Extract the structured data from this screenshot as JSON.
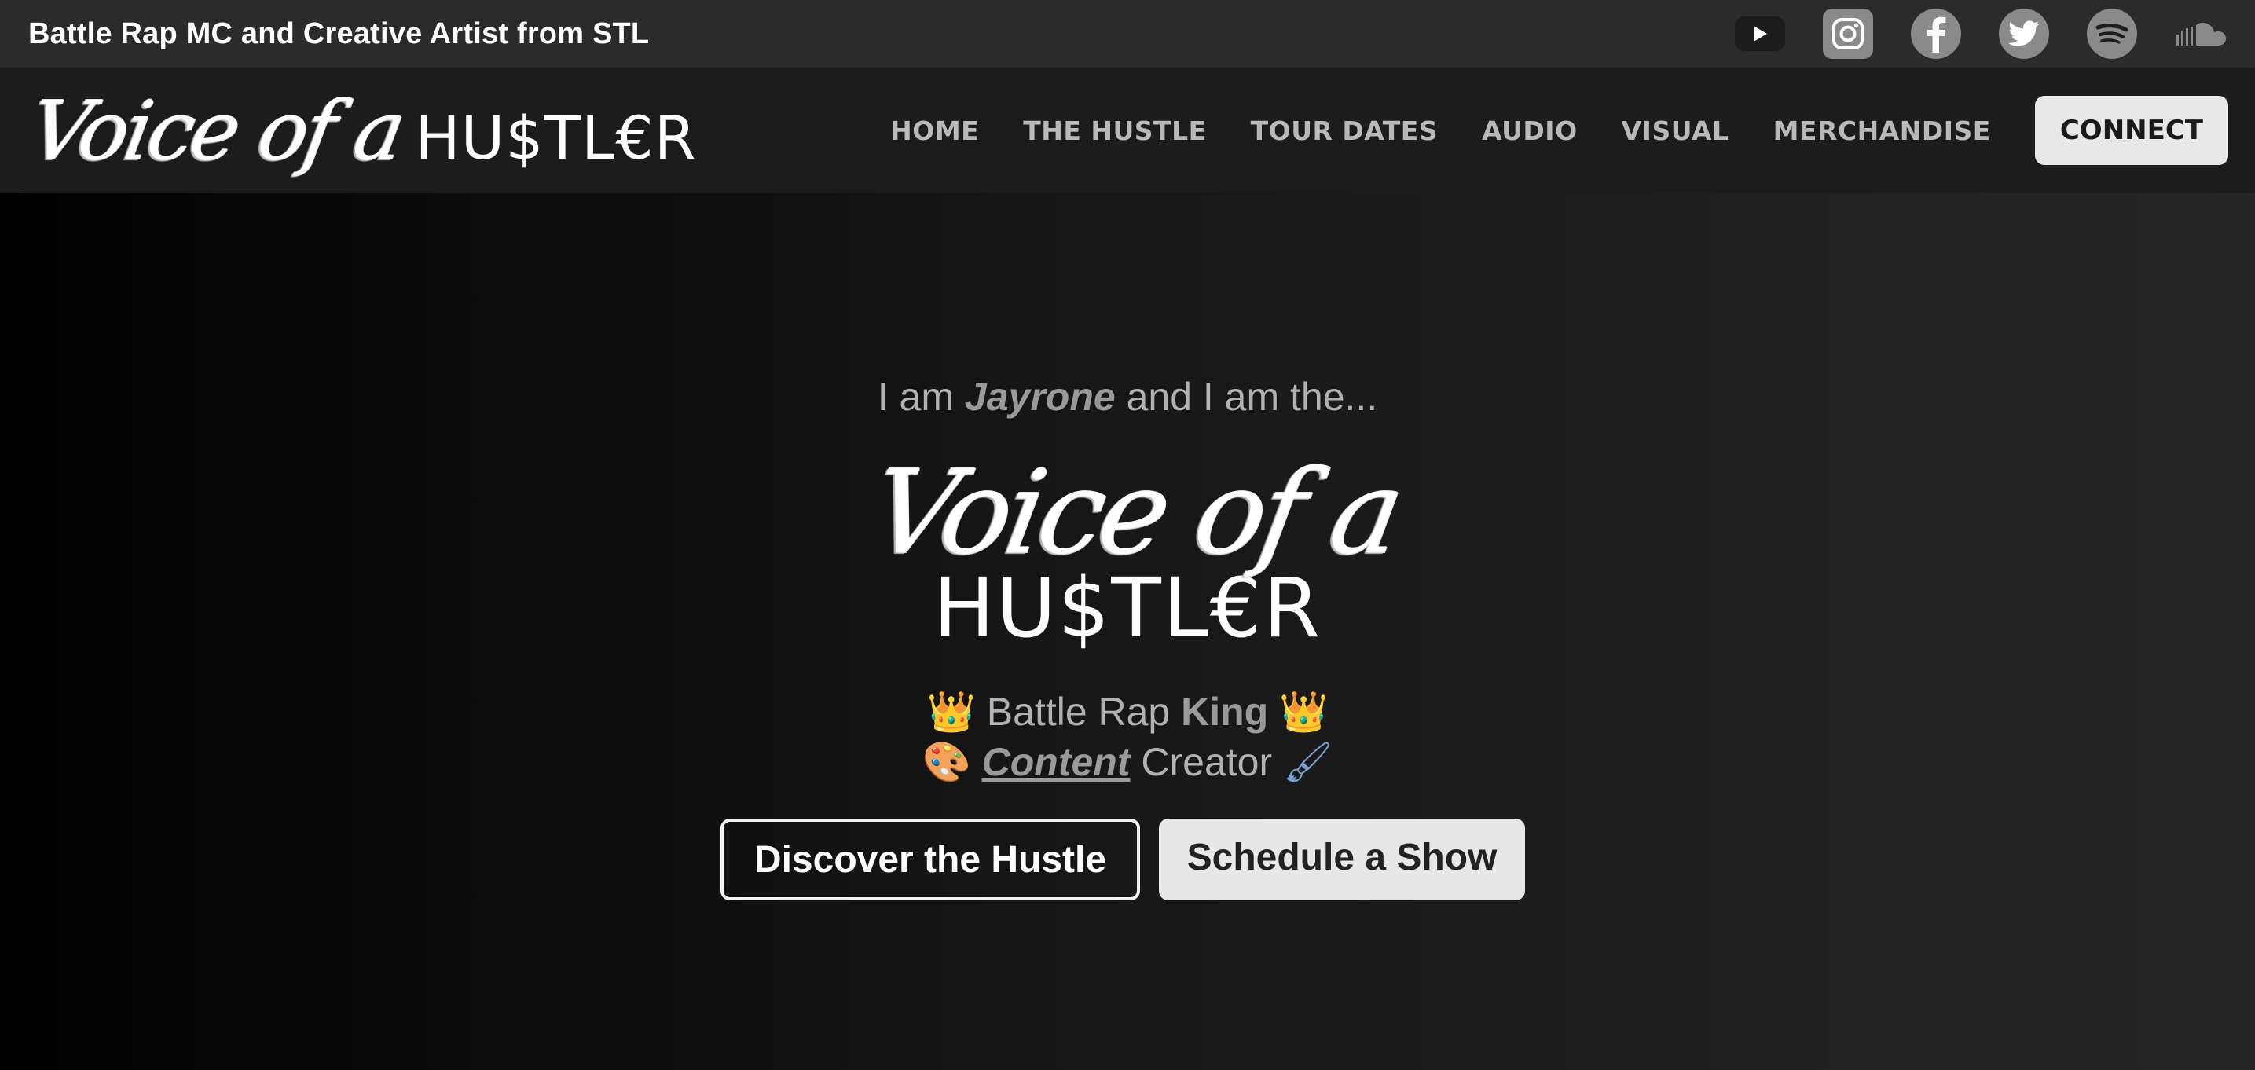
{
  "topbar": {
    "tagline": "Battle Rap MC and Creative Artist from STL",
    "socials": [
      {
        "icon": "youtube-icon"
      },
      {
        "icon": "instagram-icon"
      },
      {
        "icon": "facebook-icon"
      },
      {
        "icon": "twitter-icon"
      },
      {
        "icon": "spotify-icon"
      },
      {
        "icon": "soundcloud-icon"
      }
    ]
  },
  "nav": {
    "brand_script": "Voice of a",
    "brand_word": "HU$TL€R",
    "links": [
      "HOME",
      "THE HUSTLE",
      "TOUR DATES",
      "AUDIO",
      "VISUAL",
      "MERCHANDISE"
    ],
    "connect_label": "CONNECT"
  },
  "hero": {
    "intro_pre": "I am ",
    "intro_name": "Jayrone",
    "intro_post": " and I am the...",
    "logo_script": "Voice of a",
    "logo_word": "HU$TL€R",
    "line1_emoji_left": "👑",
    "line1_text": "Battle Rap ",
    "line1_strong": "King",
    "line1_emoji_right": "👑",
    "line2_emoji_left": "🎨",
    "line2_strong": "Content",
    "line2_text": " Creator ",
    "line2_emoji_right": "🖌",
    "btn_discover": "Discover the Hustle",
    "btn_schedule": "Schedule a Show"
  },
  "colors": {
    "topbar_bg": "#2b2b2b",
    "nav_bg": "#1c1c1c",
    "nav_link": "#b9b9b9",
    "button_light": "#e8e8e8",
    "icon_grey": "#8a8a8a"
  }
}
